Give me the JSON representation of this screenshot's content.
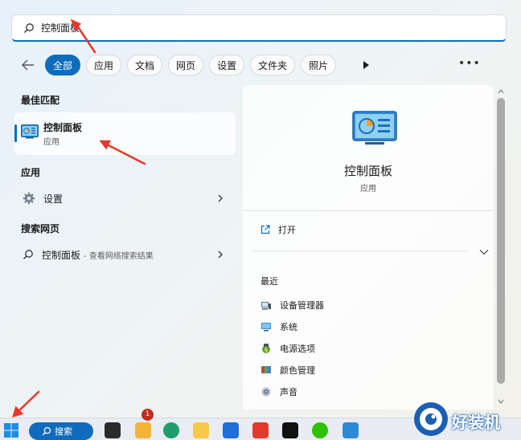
{
  "search": {
    "value": "控制面板"
  },
  "filters": [
    {
      "label": "全部",
      "active": true
    },
    {
      "label": "应用"
    },
    {
      "label": "文档"
    },
    {
      "label": "网页"
    },
    {
      "label": "设置"
    },
    {
      "label": "文件夹"
    },
    {
      "label": "照片"
    }
  ],
  "more_label": "•••",
  "left": {
    "best_match_title": "最佳匹配",
    "best_match": {
      "name": "控制面板",
      "type": "应用"
    },
    "apps_title": "应用",
    "apps": [
      {
        "label": "设置"
      }
    ],
    "web_title": "搜索网页",
    "web": {
      "query": "控制面板",
      "suffix": "- 查看网络搜索结果"
    }
  },
  "right": {
    "title": "控制面板",
    "type": "应用",
    "open_label": "打开",
    "recent_title": "最近",
    "recent": [
      {
        "label": "设备管理器",
        "icon": "device-manager-icon"
      },
      {
        "label": "系统",
        "icon": "system-icon"
      },
      {
        "label": "电源选项",
        "icon": "power-options-icon"
      },
      {
        "label": "颜色管理",
        "icon": "color-management-icon"
      },
      {
        "label": "声音",
        "icon": "sound-icon"
      }
    ]
  },
  "taskbar": {
    "search_label": "搜索",
    "badge_count": "1"
  },
  "watermark": {
    "text": "好装机"
  },
  "colors": {
    "accent": "#0f6cbd",
    "annotation": "#e8372a"
  }
}
